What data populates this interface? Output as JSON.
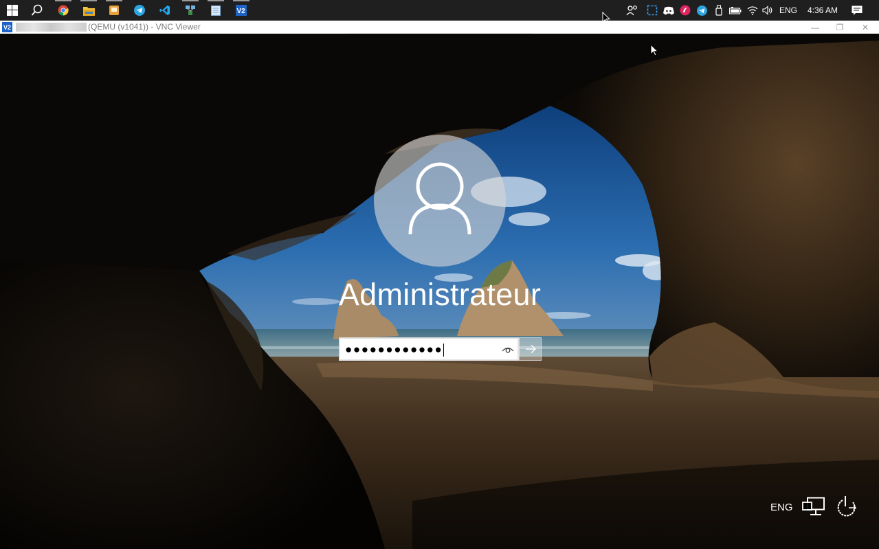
{
  "taskbar": {
    "apps": [
      {
        "name": "start",
        "icon": "windows-logo-icon"
      },
      {
        "name": "search",
        "icon": "search-icon"
      },
      {
        "name": "chrome",
        "icon": "chrome-icon"
      },
      {
        "name": "file-explorer",
        "icon": "folder-icon"
      },
      {
        "name": "app-orange",
        "icon": "app-icon"
      },
      {
        "name": "telegram",
        "icon": "telegram-icon"
      },
      {
        "name": "vscode",
        "icon": "vscode-icon"
      },
      {
        "name": "network-app",
        "icon": "network-app-icon"
      },
      {
        "name": "notepad",
        "icon": "notepad-icon"
      },
      {
        "name": "vnc-viewer",
        "icon": "vnc-viewer-icon"
      }
    ],
    "tray": {
      "language": "ENG",
      "time": "4:36 AM"
    }
  },
  "vnc_window": {
    "logo_text": "V2",
    "title": "(QEMU (v1041)) - VNC Viewer",
    "minimize": "—",
    "maximize": "❐",
    "close": "✕"
  },
  "lock_screen": {
    "username": "Administrateur",
    "password_value": "●●●●●●●●●●●●",
    "language": "ENG"
  },
  "colors": {
    "taskbar_bg": "#1f1f1f",
    "vnc_blue": "#1e64c8",
    "sky": "#2f6fb0"
  }
}
